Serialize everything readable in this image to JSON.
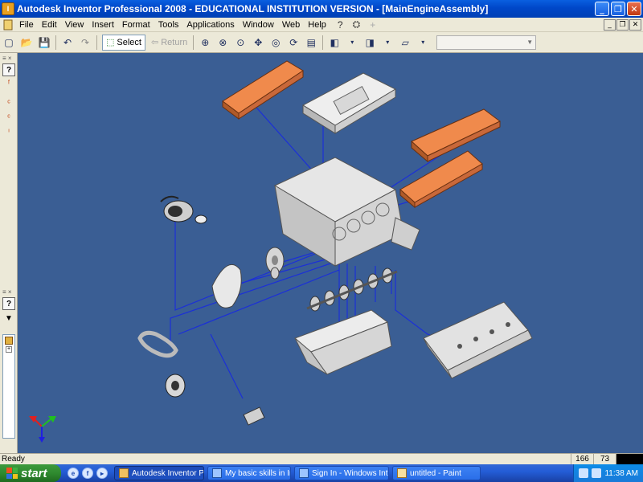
{
  "window": {
    "title": "Autodesk Inventor Professional 2008 - EDUCATIONAL INSTITUTION VERSION - [MainEngineAssembly]",
    "app_icon_letter": "I"
  },
  "menu": {
    "items": [
      "File",
      "Edit",
      "View",
      "Insert",
      "Format",
      "Tools",
      "Applications",
      "Window",
      "Web",
      "Help"
    ]
  },
  "toolbar": {
    "select_label": "Select",
    "return_label": "Return"
  },
  "status": {
    "text": "Ready",
    "x": "166",
    "y": "73"
  },
  "taskbar": {
    "start_label": "start",
    "tasks": [
      {
        "label": "Autodesk Inventor Pr..."
      },
      {
        "label": "My basic skills in Inve..."
      },
      {
        "label": "Sign In - Windows Int..."
      },
      {
        "label": "untitled - Paint"
      }
    ],
    "clock": "11:38 AM"
  },
  "colors": {
    "canvas_bg": "#3a5e94",
    "cover_orange": "#e0763c",
    "leader_line": "#1b2fd8",
    "part_gray": "#d8d8d8"
  }
}
